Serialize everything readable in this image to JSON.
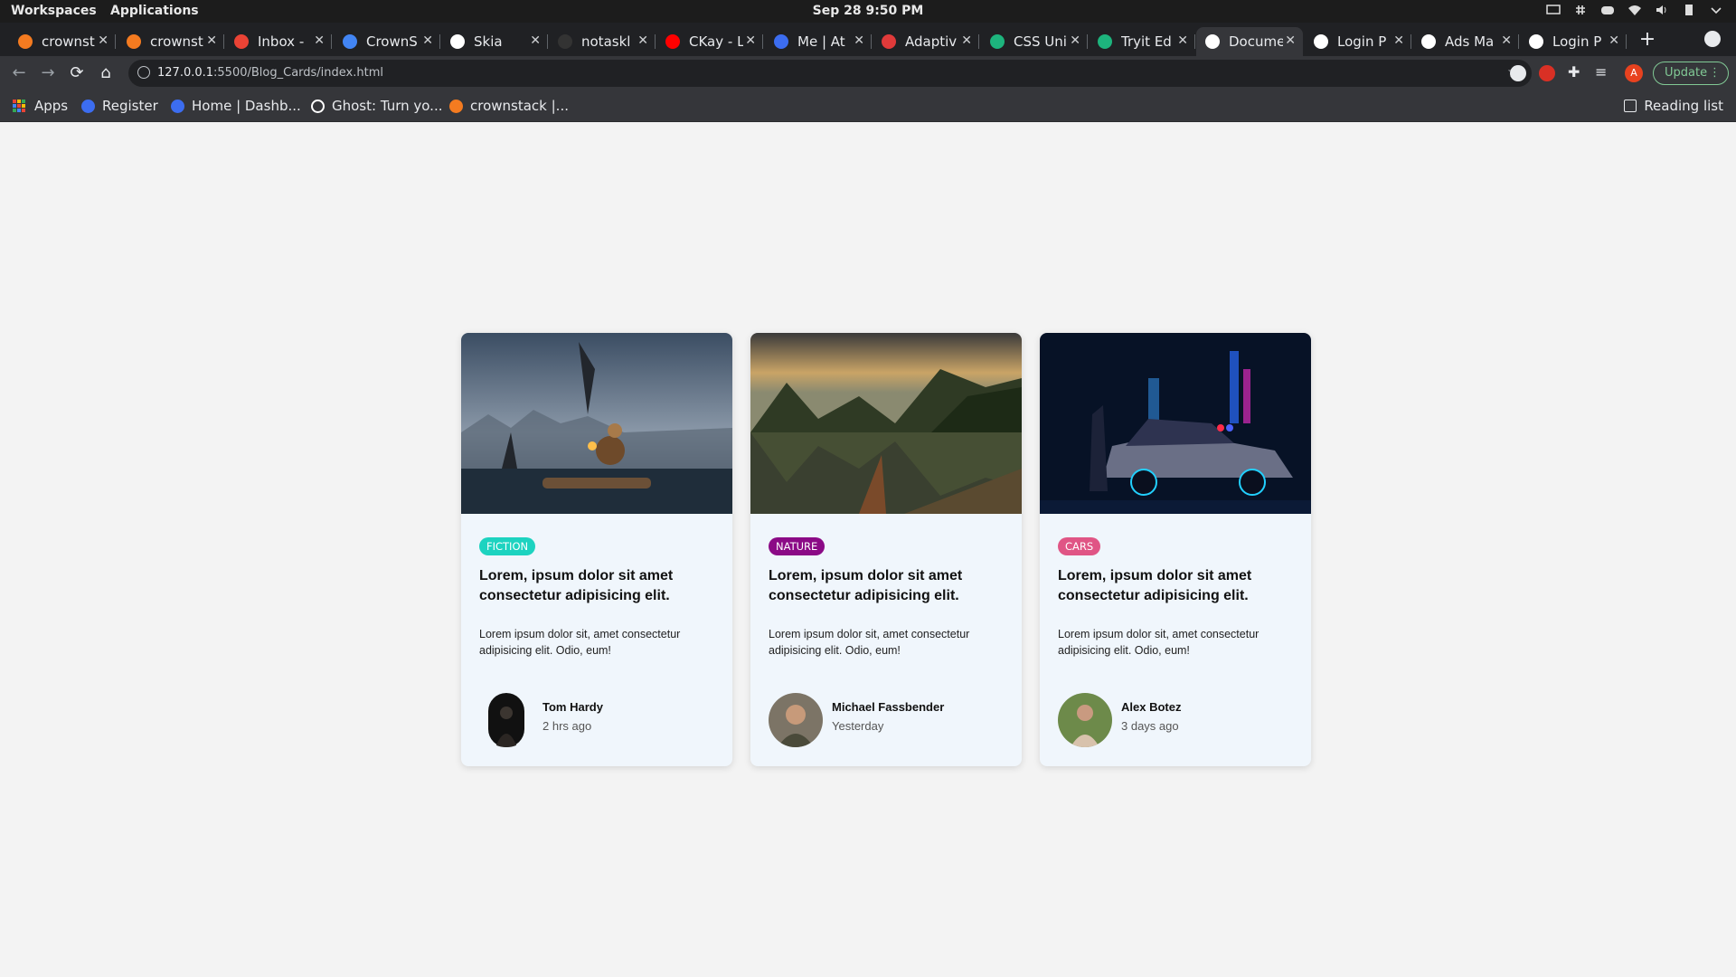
{
  "os": {
    "workspaces": "Workspaces",
    "applications": "Applications",
    "clock": "Sep 28   9:50 PM"
  },
  "tabs": [
    {
      "title": "crownst",
      "favicon_color": "#f47b20"
    },
    {
      "title": "crownst",
      "favicon_color": "#f47b20"
    },
    {
      "title": "Inbox -",
      "favicon_color": "#ea4335"
    },
    {
      "title": "CrownS",
      "favicon_color": "#4285f4"
    },
    {
      "title": "Skia",
      "favicon_color": "#ffffff"
    },
    {
      "title": "notaskl",
      "favicon_color": "#333333"
    },
    {
      "title": "CKay - L",
      "favicon_color": "#ff0000"
    },
    {
      "title": "Me | At",
      "favicon_color": "#3c6df0"
    },
    {
      "title": "Adaptiv",
      "favicon_color": "#e03a3a"
    },
    {
      "title": "CSS Uni",
      "favicon_color": "#1db47d"
    },
    {
      "title": "Tryit Ed",
      "favicon_color": "#1db47d"
    },
    {
      "title": "Docume",
      "favicon_color": "#ffffff",
      "active": true
    },
    {
      "title": "Login P",
      "favicon_color": "#ffffff"
    },
    {
      "title": "Ads Ma",
      "favicon_color": "#ffffff"
    },
    {
      "title": "Login P",
      "favicon_color": "#ffffff"
    }
  ],
  "address": {
    "host": "127.0.0.1",
    "rest": ":5500/Blog_Cards/index.html"
  },
  "toolbar": {
    "profile_initial": "A",
    "update_label": "Update"
  },
  "bookmarks": [
    {
      "label": "Apps",
      "icon": "apps-grid-icon"
    },
    {
      "label": "Register",
      "icon": "k-icon",
      "color": "#3c6df0"
    },
    {
      "label": "Home | Dashb...",
      "icon": "k-icon",
      "color": "#3c6df0"
    },
    {
      "label": "Ghost: Turn yo...",
      "icon": "ghost-icon",
      "color": "#ffffff"
    },
    {
      "label": "crownstack |...",
      "icon": "crownstack-icon",
      "color": "#f47b20"
    }
  ],
  "reading_list": "Reading list",
  "cards": [
    {
      "tag": "FICTION",
      "tag_color": "#1dd3c0",
      "title": "Lorem, ipsum dolor sit amet consectetur adipisicing elit.",
      "desc": "Lorem ipsum dolor sit, amet consectetur adipisicing elit. Odio, eum!",
      "author": "Tom Hardy",
      "time": "2 hrs ago"
    },
    {
      "tag": "NATURE",
      "tag_color": "#8b0a86",
      "title": "Lorem, ipsum dolor sit amet consectetur adipisicing elit.",
      "desc": "Lorem ipsum dolor sit, amet consectetur adipisicing elit. Odio, eum!",
      "author": "Michael Fassbender",
      "time": "Yesterday"
    },
    {
      "tag": "CARS",
      "tag_color": "#e05585",
      "title": "Lorem, ipsum dolor sit amet consectetur adipisicing elit.",
      "desc": "Lorem ipsum dolor sit, amet consectetur adipisicing elit. Odio, eum!",
      "author": "Alex Botez",
      "time": "3 days ago"
    }
  ]
}
